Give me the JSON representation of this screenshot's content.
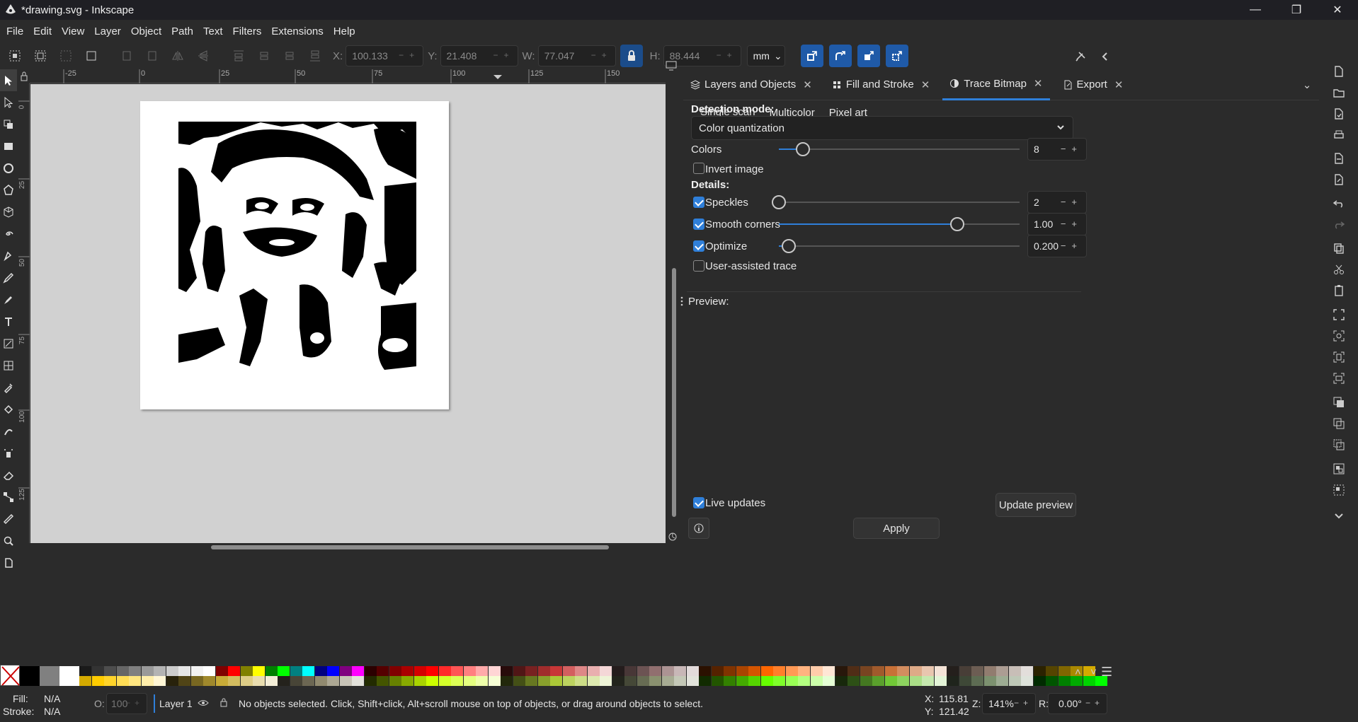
{
  "window": {
    "title": "*drawing.svg - Inkscape",
    "controls": [
      "minimize",
      "restore",
      "close"
    ]
  },
  "menu": [
    "File",
    "Edit",
    "View",
    "Layer",
    "Object",
    "Path",
    "Text",
    "Filters",
    "Extensions",
    "Help"
  ],
  "toolbar": {
    "x_label": "X:",
    "x_value": "100.133",
    "y_label": "Y:",
    "y_value": "21.408",
    "w_label": "W:",
    "w_value": "77.047",
    "h_label": "H:",
    "h_value": "88.444",
    "unit": "mm"
  },
  "ruler": {
    "top_ticks": [
      "-25",
      "0",
      "25",
      "50",
      "75",
      "100",
      "125",
      "150"
    ],
    "left_ticks": [
      "0",
      "25",
      "50",
      "75",
      "100",
      "125"
    ]
  },
  "dock": {
    "tabs": [
      {
        "label": "Layers and Objects",
        "icon": "layers-icon"
      },
      {
        "label": "Fill and Stroke",
        "icon": "fill-stroke-icon"
      },
      {
        "label": "Trace Bitmap",
        "icon": "trace-bitmap-icon",
        "active": true
      },
      {
        "label": "Export",
        "icon": "export-icon"
      }
    ],
    "subtabs": [
      "Single scan",
      "Multicolor",
      "Pixel art"
    ],
    "active_subtab": "Single scan",
    "detection_mode_label": "Detection mode:",
    "detection_mode_value": "Color quantization",
    "colors_label": "Colors",
    "colors_value": "8",
    "colors_fraction": 0.1,
    "invert_label": "Invert image",
    "invert_checked": false,
    "details_label": "Details:",
    "speckles_label": "Speckles",
    "speckles_checked": true,
    "speckles_value": "2",
    "speckles_fraction": 0.0,
    "smooth_label": "Smooth corners",
    "smooth_checked": true,
    "smooth_value": "1.00",
    "smooth_fraction": 0.74,
    "optimize_label": "Optimize",
    "optimize_checked": true,
    "optimize_value": "0.200",
    "optimize_fraction": 0.04,
    "user_assisted_label": "User-assisted trace",
    "user_assisted_checked": false,
    "preview_label": "Preview:",
    "live_updates_label": "Live updates",
    "live_updates_checked": true,
    "update_preview_label": "Update preview",
    "apply_label": "Apply"
  },
  "status": {
    "fill_label": "Fill:",
    "fill_value": "N/A",
    "stroke_label": "Stroke:",
    "stroke_value": "N/A",
    "opacity_label": "O:",
    "opacity_value": "100",
    "layer_name": "Layer 1",
    "message": "No objects selected. Click, Shift+click, Alt+scroll mouse on top of objects, or drag around objects to select.",
    "cursor_x_label": "X:",
    "cursor_x": "115.81",
    "cursor_y_label": "Y:",
    "cursor_y": "121.42",
    "zoom_label": "Z:",
    "zoom": "141%",
    "rotation_label": "R:",
    "rotation": "0.00°"
  },
  "colors": {
    "accent": "#2f7fd9",
    "panel_bg": "#2b2b2b",
    "canvas_bg": "#d1d1d1"
  }
}
